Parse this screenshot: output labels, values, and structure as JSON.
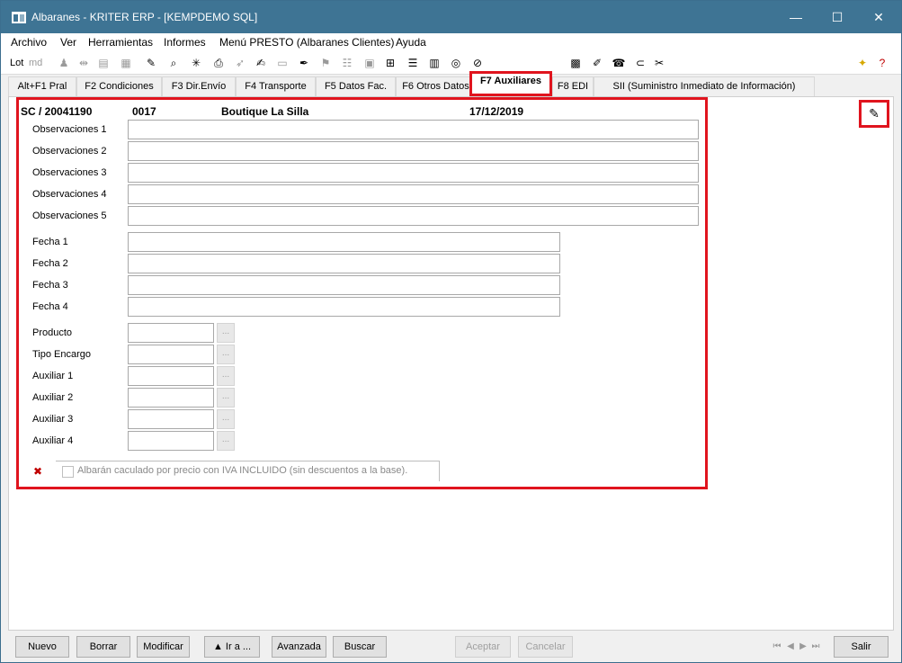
{
  "window": {
    "title": "Albaranes - KRITER ERP -  [KEMPDEMO SQL]",
    "minimize": "—",
    "maximize": "☐",
    "close": "✕"
  },
  "menu": [
    "Archivo",
    "Ver",
    "Herramientas",
    "Informes",
    "Menú PRESTO (Albaranes Clientes)",
    "Ayuda"
  ],
  "toolbar": {
    "lot_label": "Lot",
    "md_label": "md"
  },
  "tabs": [
    "Alt+F1 Pral",
    "F2 Condiciones",
    "F3 Dir.Envío",
    "F4 Transporte",
    "F5 Datos Fac.",
    "F6 Otros Datos",
    "F7 Auxiliares",
    "F8 EDI",
    "SII (Suministro Inmediato de Información)"
  ],
  "record": {
    "doc": "SC / 20041190",
    "code": "0017",
    "customer": "Boutique La Silla",
    "date": "17/12/2019"
  },
  "fields": {
    "obs1": "Observaciones 1",
    "obs2": "Observaciones 2",
    "obs3": "Observaciones 3",
    "obs4": "Observaciones 4",
    "obs5": "Observaciones 5",
    "fecha1": "Fecha 1",
    "fecha2": "Fecha 2",
    "fecha3": "Fecha 3",
    "fecha4": "Fecha 4",
    "producto": "Producto",
    "tipo_encargo": "Tipo Encargo",
    "aux1": "Auxiliar 1",
    "aux2": "Auxiliar 2",
    "aux3": "Auxiliar 3",
    "aux4": "Auxiliar 4",
    "ellipsis": "..."
  },
  "checkbox": {
    "label": "Albarán caculado por precio con IVA INCLUIDO (sin descuentos a la base)."
  },
  "buttons": {
    "nuevo": "Nuevo",
    "borrar": "Borrar",
    "modificar": "Modificar",
    "ir_a": "▲  Ir a ...",
    "avanzada": "Avanzada",
    "buscar": "Buscar",
    "aceptar": "Aceptar",
    "cancelar": "Cancelar",
    "salir": "Salir"
  },
  "colors": {
    "titlebar": "#3e7494",
    "highlight": "#e0141e"
  }
}
